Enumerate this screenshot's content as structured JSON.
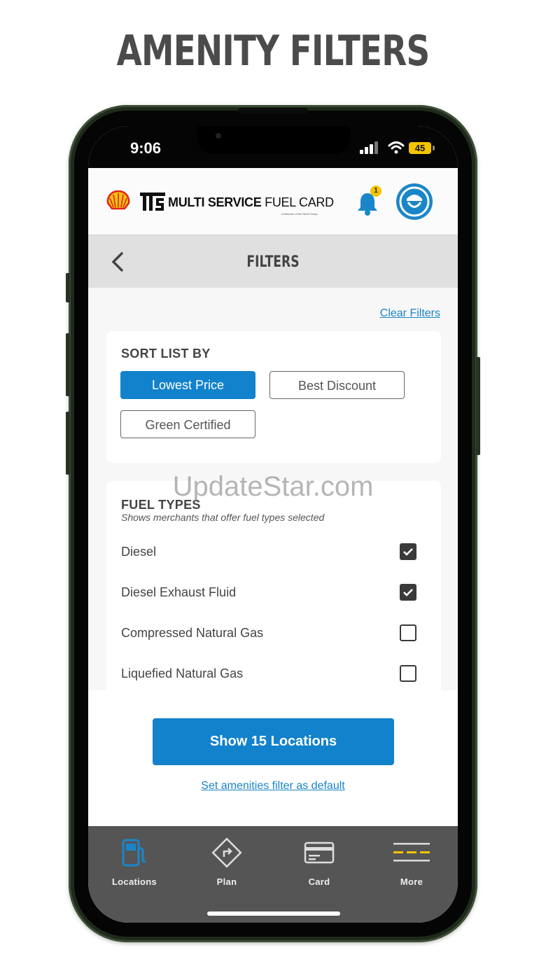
{
  "headline": "AMENITY FILTERS",
  "status_bar": {
    "time": "9:06",
    "battery": "45"
  },
  "app_header": {
    "brand_mark": "MS",
    "brand_name_bold": "MULTI SERVICE",
    "brand_name_light": " FUEL CARD",
    "brand_tagline": "A Member of the Shell Group",
    "notification_count": "1"
  },
  "filters_bar": {
    "title": "FILTERS"
  },
  "clear_filters": "Clear Filters",
  "sort": {
    "title": "SORT LIST BY",
    "options": [
      {
        "label": "Lowest Price",
        "selected": true
      },
      {
        "label": "Best Discount",
        "selected": false
      },
      {
        "label": "Green Certified",
        "selected": false
      }
    ]
  },
  "fuel_types": {
    "title": "FUEL TYPES",
    "subtitle": "Shows merchants that offer fuel types selected",
    "items": [
      {
        "label": "Diesel",
        "checked": true
      },
      {
        "label": "Diesel Exhaust Fluid",
        "checked": true
      },
      {
        "label": "Compressed Natural Gas",
        "checked": false
      },
      {
        "label": "Liquefied Natural Gas",
        "checked": false
      }
    ]
  },
  "show_button": "Show 15 Locations",
  "default_link": "Set amenities filter as default",
  "tabs": [
    {
      "label": "Locations",
      "icon": "fuel-pump-icon",
      "active": true
    },
    {
      "label": "Plan",
      "icon": "route-sign-icon",
      "active": false
    },
    {
      "label": "Card",
      "icon": "card-icon",
      "active": false
    },
    {
      "label": "More",
      "icon": "menu-icon",
      "active": false
    }
  ],
  "colors": {
    "accent": "#1282cc",
    "link": "#1a84c6",
    "tabbar": "#555555",
    "badge": "#f5c400"
  },
  "watermark": "UpdateStar.com"
}
